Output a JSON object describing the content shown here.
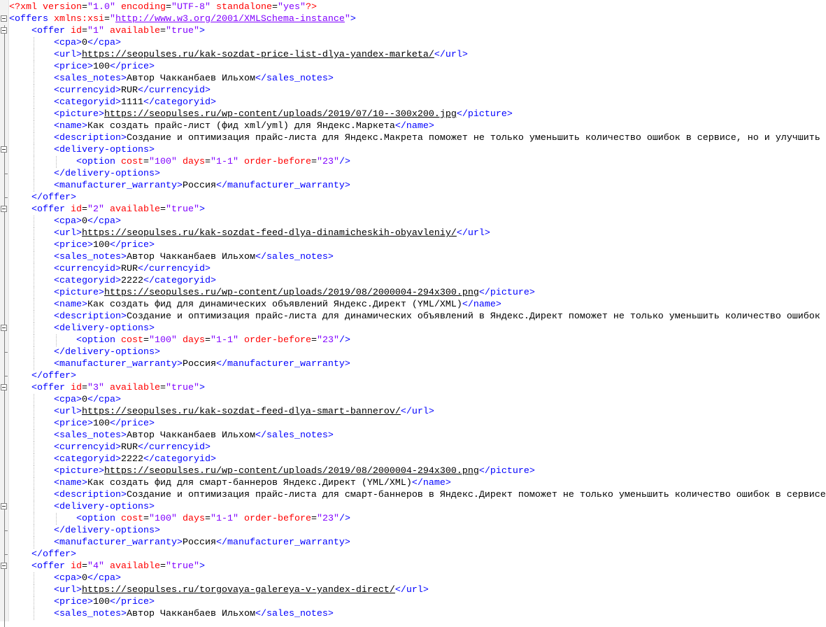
{
  "lines": [
    {
      "depth": 0,
      "fold": "",
      "tokens": [
        [
          "d",
          "<?xml "
        ],
        [
          "a",
          "version"
        ],
        [
          "e",
          "="
        ],
        [
          "v",
          "\"1.0\""
        ],
        [
          "a",
          " encoding"
        ],
        [
          "e",
          "="
        ],
        [
          "v",
          "\"UTF-8\""
        ],
        [
          "a",
          " standalone"
        ],
        [
          "e",
          "="
        ],
        [
          "v",
          "\"yes\""
        ],
        [
          "d",
          "?>"
        ]
      ]
    },
    {
      "depth": 0,
      "fold": "open",
      "tokens": [
        [
          "t",
          "<offers "
        ],
        [
          "a",
          "xmlns:xsi"
        ],
        [
          "e",
          "="
        ],
        [
          "v",
          "\""
        ],
        [
          "vu",
          "http://www.w3.org/2001/XMLSchema-instance"
        ],
        [
          "v",
          "\""
        ],
        [
          "t",
          ">"
        ]
      ]
    },
    {
      "depth": 1,
      "fold": "open",
      "tokens": [
        [
          "t",
          "<offer "
        ],
        [
          "a",
          "id"
        ],
        [
          "e",
          "="
        ],
        [
          "v",
          "\"1\""
        ],
        [
          "a",
          " available"
        ],
        [
          "e",
          "="
        ],
        [
          "v",
          "\"true\""
        ],
        [
          "t",
          ">"
        ]
      ]
    },
    {
      "depth": 2,
      "fold": "",
      "tokens": [
        [
          "t",
          "<cpa>"
        ],
        [
          "x",
          "0"
        ],
        [
          "t",
          "</cpa>"
        ]
      ]
    },
    {
      "depth": 2,
      "fold": "",
      "tokens": [
        [
          "t",
          "<url>"
        ],
        [
          "u",
          "https://seopulses.ru/kak-sozdat-price-list-dlya-yandex-marketa/"
        ],
        [
          "t",
          "</url>"
        ]
      ]
    },
    {
      "depth": 2,
      "fold": "",
      "tokens": [
        [
          "t",
          "<price>"
        ],
        [
          "x",
          "100"
        ],
        [
          "t",
          "</price>"
        ]
      ]
    },
    {
      "depth": 2,
      "fold": "",
      "tokens": [
        [
          "t",
          "<sales_notes>"
        ],
        [
          "x",
          "Автор Чакканбаев Ильхом"
        ],
        [
          "t",
          "</sales_notes>"
        ]
      ]
    },
    {
      "depth": 2,
      "fold": "",
      "tokens": [
        [
          "t",
          "<currencyid>"
        ],
        [
          "x",
          "RUR"
        ],
        [
          "t",
          "</currencyid>"
        ]
      ]
    },
    {
      "depth": 2,
      "fold": "",
      "tokens": [
        [
          "t",
          "<categoryid>"
        ],
        [
          "x",
          "1111"
        ],
        [
          "t",
          "</categoryid>"
        ]
      ]
    },
    {
      "depth": 2,
      "fold": "",
      "tokens": [
        [
          "t",
          "<picture>"
        ],
        [
          "u",
          "https://seopulses.ru/wp-content/uploads/2019/07/10--300x200.jpg"
        ],
        [
          "t",
          "</picture>"
        ]
      ]
    },
    {
      "depth": 2,
      "fold": "",
      "tokens": [
        [
          "t",
          "<name>"
        ],
        [
          "x",
          "Как создать прайс-лист (фид xml/yml) для Яндекс.Маркета"
        ],
        [
          "t",
          "</name>"
        ]
      ]
    },
    {
      "depth": 2,
      "fold": "",
      "tokens": [
        [
          "t",
          "<description>"
        ],
        [
          "x",
          "Создание и оптимизация прайс-листа для Яндекс.Макрета поможет не только уменьшить количество ошибок в сервисе, но и улучшить"
        ]
      ]
    },
    {
      "depth": 2,
      "fold": "open",
      "tokens": [
        [
          "t",
          "<delivery-options>"
        ]
      ]
    },
    {
      "depth": 3,
      "fold": "",
      "tokens": [
        [
          "t",
          "<option "
        ],
        [
          "a",
          "cost"
        ],
        [
          "e",
          "="
        ],
        [
          "v",
          "\"100\""
        ],
        [
          "a",
          " days"
        ],
        [
          "e",
          "="
        ],
        [
          "v",
          "\"1-1\""
        ],
        [
          "a",
          " order-before"
        ],
        [
          "e",
          "="
        ],
        [
          "v",
          "\"23\""
        ],
        [
          "t",
          "/>"
        ]
      ]
    },
    {
      "depth": 2,
      "fold": "close",
      "tokens": [
        [
          "t",
          "</delivery-options>"
        ]
      ]
    },
    {
      "depth": 2,
      "fold": "",
      "tokens": [
        [
          "t",
          "<manufacturer_warranty>"
        ],
        [
          "x",
          "Россия"
        ],
        [
          "t",
          "</manufacturer_warranty>"
        ]
      ]
    },
    {
      "depth": 1,
      "fold": "close",
      "tokens": [
        [
          "t",
          "</offer>"
        ]
      ]
    },
    {
      "depth": 1,
      "fold": "open",
      "tokens": [
        [
          "t",
          "<offer "
        ],
        [
          "a",
          "id"
        ],
        [
          "e",
          "="
        ],
        [
          "v",
          "\"2\""
        ],
        [
          "a",
          " available"
        ],
        [
          "e",
          "="
        ],
        [
          "v",
          "\"true\""
        ],
        [
          "t",
          ">"
        ]
      ]
    },
    {
      "depth": 2,
      "fold": "",
      "tokens": [
        [
          "t",
          "<cpa>"
        ],
        [
          "x",
          "0"
        ],
        [
          "t",
          "</cpa>"
        ]
      ]
    },
    {
      "depth": 2,
      "fold": "",
      "tokens": [
        [
          "t",
          "<url>"
        ],
        [
          "u",
          "https://seopulses.ru/kak-sozdat-feed-dlya-dinamicheskih-obyavleniy/"
        ],
        [
          "t",
          "</url>"
        ]
      ]
    },
    {
      "depth": 2,
      "fold": "",
      "tokens": [
        [
          "t",
          "<price>"
        ],
        [
          "x",
          "100"
        ],
        [
          "t",
          "</price>"
        ]
      ]
    },
    {
      "depth": 2,
      "fold": "",
      "tokens": [
        [
          "t",
          "<sales_notes>"
        ],
        [
          "x",
          "Автор Чакканбаев Ильхом"
        ],
        [
          "t",
          "</sales_notes>"
        ]
      ]
    },
    {
      "depth": 2,
      "fold": "",
      "tokens": [
        [
          "t",
          "<currencyid>"
        ],
        [
          "x",
          "RUR"
        ],
        [
          "t",
          "</currencyid>"
        ]
      ]
    },
    {
      "depth": 2,
      "fold": "",
      "tokens": [
        [
          "t",
          "<categoryid>"
        ],
        [
          "x",
          "2222"
        ],
        [
          "t",
          "</categoryid>"
        ]
      ]
    },
    {
      "depth": 2,
      "fold": "",
      "tokens": [
        [
          "t",
          "<picture>"
        ],
        [
          "u",
          "https://seopulses.ru/wp-content/uploads/2019/08/2000004-294x300.png"
        ],
        [
          "t",
          "</picture>"
        ]
      ]
    },
    {
      "depth": 2,
      "fold": "",
      "tokens": [
        [
          "t",
          "<name>"
        ],
        [
          "x",
          "Как создать фид для динамических объявлений Яндекс.Директ (YML/XML)"
        ],
        [
          "t",
          "</name>"
        ]
      ]
    },
    {
      "depth": 2,
      "fold": "",
      "tokens": [
        [
          "t",
          "<description>"
        ],
        [
          "x",
          "Создание и оптимизация прайс-листа для динамических объявлений в Яндекс.Директ поможет не только уменьшить количество ошибок"
        ]
      ]
    },
    {
      "depth": 2,
      "fold": "open",
      "tokens": [
        [
          "t",
          "<delivery-options>"
        ]
      ]
    },
    {
      "depth": 3,
      "fold": "",
      "tokens": [
        [
          "t",
          "<option "
        ],
        [
          "a",
          "cost"
        ],
        [
          "e",
          "="
        ],
        [
          "v",
          "\"100\""
        ],
        [
          "a",
          " days"
        ],
        [
          "e",
          "="
        ],
        [
          "v",
          "\"1-1\""
        ],
        [
          "a",
          " order-before"
        ],
        [
          "e",
          "="
        ],
        [
          "v",
          "\"23\""
        ],
        [
          "t",
          "/>"
        ]
      ]
    },
    {
      "depth": 2,
      "fold": "close",
      "tokens": [
        [
          "t",
          "</delivery-options>"
        ]
      ]
    },
    {
      "depth": 2,
      "fold": "",
      "tokens": [
        [
          "t",
          "<manufacturer_warranty>"
        ],
        [
          "x",
          "Россия"
        ],
        [
          "t",
          "</manufacturer_warranty>"
        ]
      ]
    },
    {
      "depth": 1,
      "fold": "close",
      "tokens": [
        [
          "t",
          "</offer>"
        ]
      ]
    },
    {
      "depth": 1,
      "fold": "open",
      "tokens": [
        [
          "t",
          "<offer "
        ],
        [
          "a",
          "id"
        ],
        [
          "e",
          "="
        ],
        [
          "v",
          "\"3\""
        ],
        [
          "a",
          " available"
        ],
        [
          "e",
          "="
        ],
        [
          "v",
          "\"true\""
        ],
        [
          "t",
          ">"
        ]
      ]
    },
    {
      "depth": 2,
      "fold": "",
      "tokens": [
        [
          "t",
          "<cpa>"
        ],
        [
          "x",
          "0"
        ],
        [
          "t",
          "</cpa>"
        ]
      ]
    },
    {
      "depth": 2,
      "fold": "",
      "tokens": [
        [
          "t",
          "<url>"
        ],
        [
          "u",
          "https://seopulses.ru/kak-sozdat-feed-dlya-smart-bannerov/"
        ],
        [
          "t",
          "</url>"
        ]
      ]
    },
    {
      "depth": 2,
      "fold": "",
      "tokens": [
        [
          "t",
          "<price>"
        ],
        [
          "x",
          "100"
        ],
        [
          "t",
          "</price>"
        ]
      ]
    },
    {
      "depth": 2,
      "fold": "",
      "tokens": [
        [
          "t",
          "<sales_notes>"
        ],
        [
          "x",
          "Автор Чакканбаев Ильхом"
        ],
        [
          "t",
          "</sales_notes>"
        ]
      ]
    },
    {
      "depth": 2,
      "fold": "",
      "tokens": [
        [
          "t",
          "<currencyid>"
        ],
        [
          "x",
          "RUR"
        ],
        [
          "t",
          "</currencyid>"
        ]
      ]
    },
    {
      "depth": 2,
      "fold": "",
      "tokens": [
        [
          "t",
          "<categoryid>"
        ],
        [
          "x",
          "2222"
        ],
        [
          "t",
          "</categoryid>"
        ]
      ]
    },
    {
      "depth": 2,
      "fold": "",
      "tokens": [
        [
          "t",
          "<picture>"
        ],
        [
          "u",
          "https://seopulses.ru/wp-content/uploads/2019/08/2000004-294x300.png"
        ],
        [
          "t",
          "</picture>"
        ]
      ]
    },
    {
      "depth": 2,
      "fold": "",
      "tokens": [
        [
          "t",
          "<name>"
        ],
        [
          "x",
          "Как создать фид для смарт-баннеров Яндекс.Директ (YML/XML)"
        ],
        [
          "t",
          "</name>"
        ]
      ]
    },
    {
      "depth": 2,
      "fold": "",
      "tokens": [
        [
          "t",
          "<description>"
        ],
        [
          "x",
          "Создание и оптимизация прайс-листа для смарт-баннеров в Яндекс.Директ поможет не только уменьшить количество ошибок в сервисе"
        ]
      ]
    },
    {
      "depth": 2,
      "fold": "open",
      "tokens": [
        [
          "t",
          "<delivery-options>"
        ]
      ]
    },
    {
      "depth": 3,
      "fold": "",
      "tokens": [
        [
          "t",
          "<option "
        ],
        [
          "a",
          "cost"
        ],
        [
          "e",
          "="
        ],
        [
          "v",
          "\"100\""
        ],
        [
          "a",
          " days"
        ],
        [
          "e",
          "="
        ],
        [
          "v",
          "\"1-1\""
        ],
        [
          "a",
          " order-before"
        ],
        [
          "e",
          "="
        ],
        [
          "v",
          "\"23\""
        ],
        [
          "t",
          "/>"
        ]
      ]
    },
    {
      "depth": 2,
      "fold": "close",
      "tokens": [
        [
          "t",
          "</delivery-options>"
        ]
      ]
    },
    {
      "depth": 2,
      "fold": "",
      "tokens": [
        [
          "t",
          "<manufacturer_warranty>"
        ],
        [
          "x",
          "Россия"
        ],
        [
          "t",
          "</manufacturer_warranty>"
        ]
      ]
    },
    {
      "depth": 1,
      "fold": "close",
      "tokens": [
        [
          "t",
          "</offer>"
        ]
      ]
    },
    {
      "depth": 1,
      "fold": "open",
      "tokens": [
        [
          "t",
          "<offer "
        ],
        [
          "a",
          "id"
        ],
        [
          "e",
          "="
        ],
        [
          "v",
          "\"4\""
        ],
        [
          "a",
          " available"
        ],
        [
          "e",
          "="
        ],
        [
          "v",
          "\"true\""
        ],
        [
          "t",
          ">"
        ]
      ]
    },
    {
      "depth": 2,
      "fold": "",
      "tokens": [
        [
          "t",
          "<cpa>"
        ],
        [
          "x",
          "0"
        ],
        [
          "t",
          "</cpa>"
        ]
      ]
    },
    {
      "depth": 2,
      "fold": "",
      "tokens": [
        [
          "t",
          "<url>"
        ],
        [
          "u",
          "https://seopulses.ru/torgovaya-galereya-v-yandex-direct/"
        ],
        [
          "t",
          "</url>"
        ]
      ]
    },
    {
      "depth": 2,
      "fold": "",
      "tokens": [
        [
          "t",
          "<price>"
        ],
        [
          "x",
          "100"
        ],
        [
          "t",
          "</price>"
        ]
      ]
    },
    {
      "depth": 2,
      "fold": "",
      "tokens": [
        [
          "t",
          "<sales_notes>"
        ],
        [
          "x",
          "Автор Чакканбаев Ильхом"
        ],
        [
          "t",
          "</sales_notes>"
        ]
      ]
    }
  ]
}
